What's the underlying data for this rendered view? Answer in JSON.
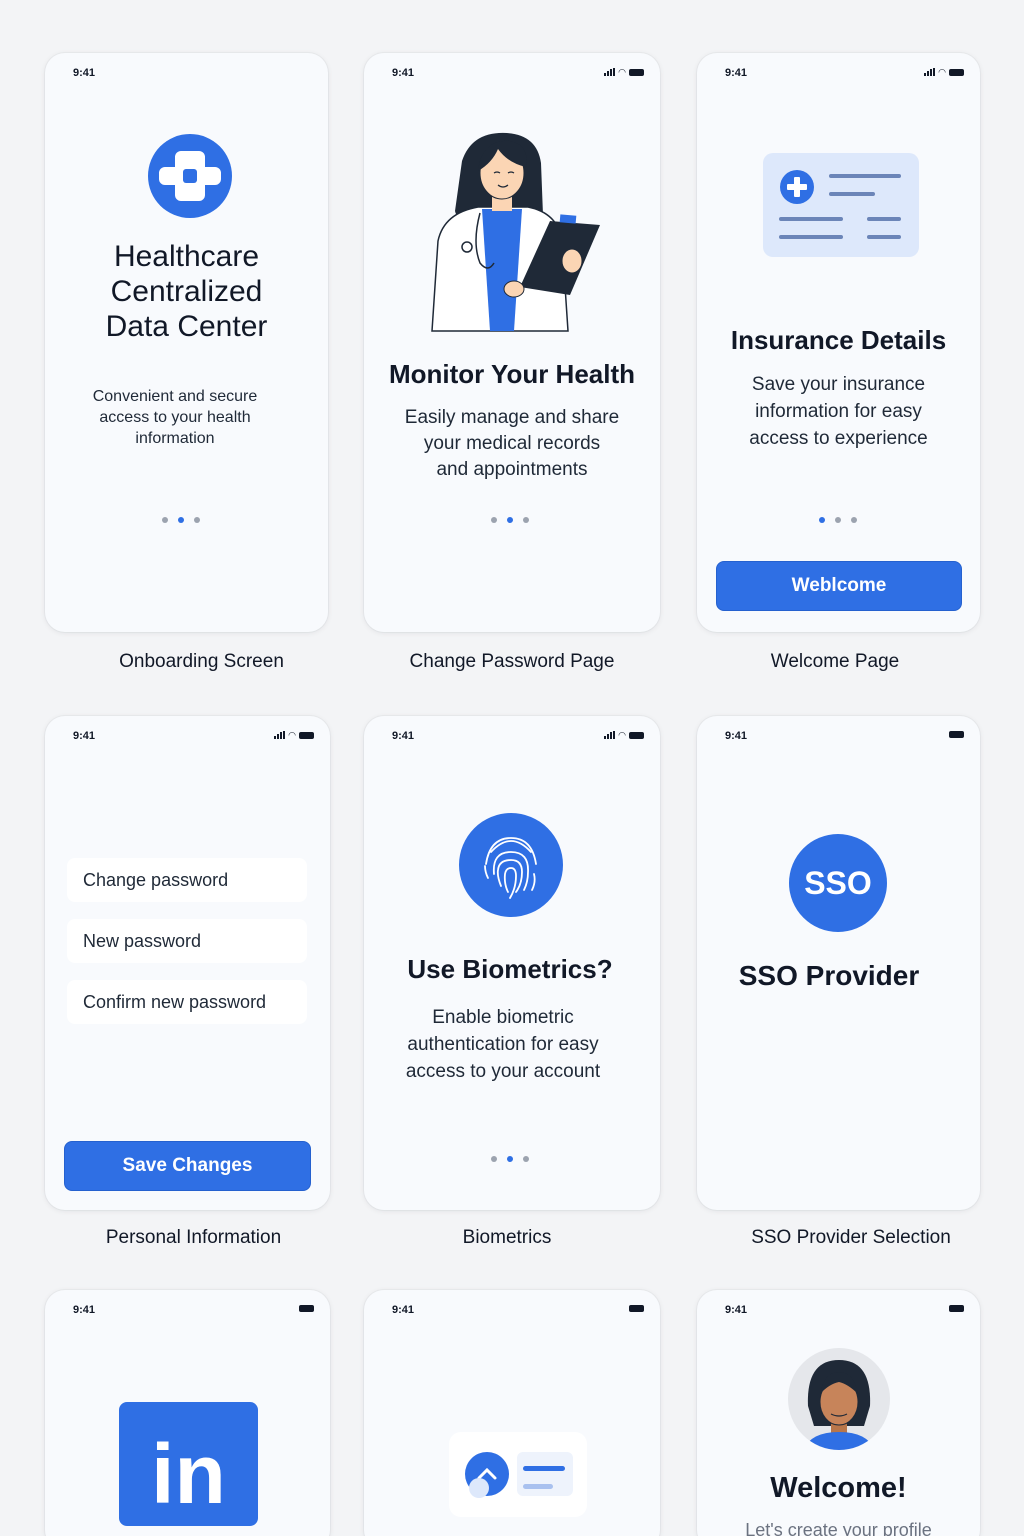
{
  "colors": {
    "accent": "#2f6fe4",
    "background": "#f3f4f6",
    "card": "#f8fafd"
  },
  "status_time": "9:41",
  "screens": {
    "onboarding": {
      "caption": "Onboarding Screen",
      "icon": "medical-cross-icon",
      "title": [
        "Healthcare",
        "Centralized",
        "Data Center"
      ],
      "body": [
        "Convenient and secure",
        "access to your health",
        "information"
      ]
    },
    "change_password": {
      "caption": "Change Password Page",
      "illustration": "doctor-with-clipboard",
      "title": "Monitor Your Health",
      "body": [
        "Easily manage and share",
        "your medical records",
        "and appointments"
      ]
    },
    "welcome": {
      "caption": "Welcome Page",
      "illustration": "insurance-card",
      "title": "Insurance Details",
      "body": [
        "Save your insurance",
        "information for easy",
        "access to experience"
      ],
      "button_label": "Weblcome"
    },
    "personal_info": {
      "caption": "Personal Information",
      "fields": [
        "Change password",
        "New password",
        "Confirm new password"
      ],
      "button_label": "Save Changes"
    },
    "biometrics": {
      "caption": "Biometrics",
      "icon": "fingerprint-icon",
      "title": "Use Biometrics?",
      "body": [
        "Enable biometric",
        "authentication for easy",
        "access to your account"
      ]
    },
    "sso": {
      "caption": "SSO Provider Selection",
      "badge": "SSO",
      "title": "SSO Provider"
    },
    "linkedin": {
      "icon": "linkedin-icon",
      "logo_text": "in"
    },
    "profile_card": {
      "illustration": "profile-card"
    },
    "welcome_profile": {
      "title": "Welcome!",
      "body": "Let's create your profile"
    }
  }
}
